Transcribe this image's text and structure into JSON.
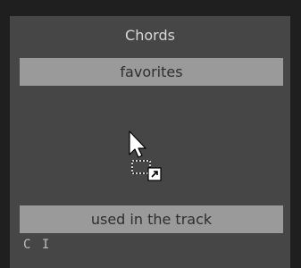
{
  "panel": {
    "title": "Chords",
    "favorites": {
      "label": "favorites"
    },
    "used": {
      "label": "used in the track",
      "items": [
        {
          "label": "C I"
        }
      ]
    }
  },
  "cursor": {
    "icon": "drag-shortcut-cursor-icon"
  }
}
